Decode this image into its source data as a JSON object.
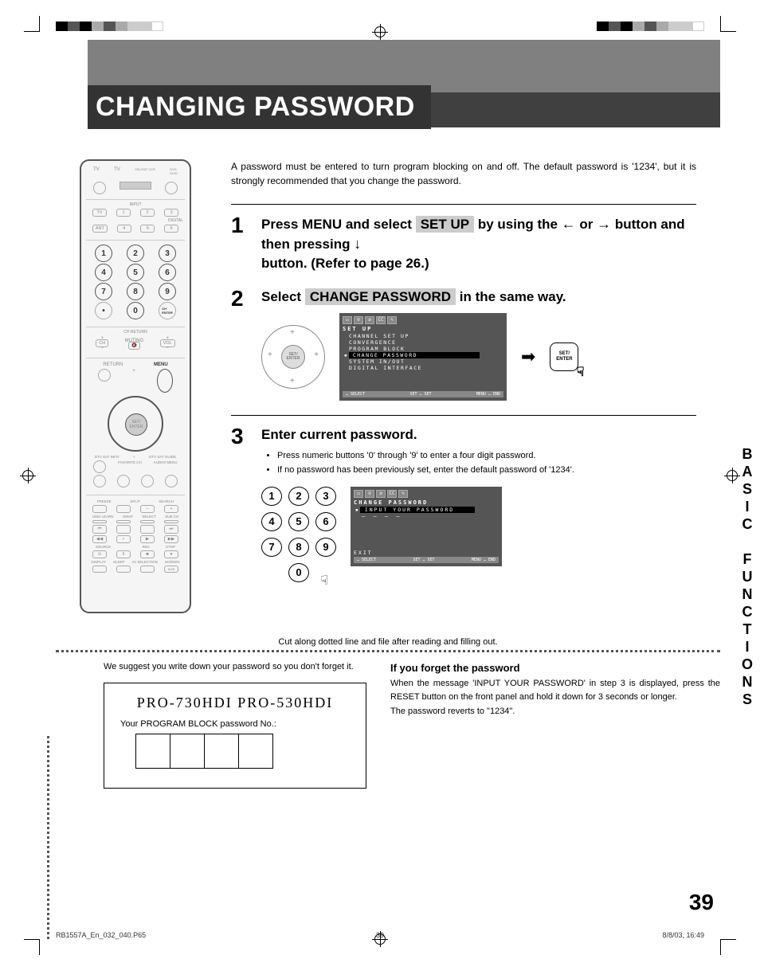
{
  "title": "CHANGING PASSWORD",
  "intro": "A password must be entered to turn program blocking on and off. The default password is '1234', but it is strongly recommended that you change the password.",
  "steps": {
    "s1": {
      "num": "1",
      "part1": "Press MENU and select ",
      "highlight": "SET UP",
      "part2": " by using the ",
      "arrow_left": "←",
      "part3": " or ",
      "arrow_right": "→",
      "part4": " button and then pressing ",
      "arrow_down": "↓",
      "part5": "button. (Refer to page 26.)"
    },
    "s2": {
      "num": "2",
      "part1": "Select ",
      "highlight": "CHANGE PASSWORD",
      "part2": " in the same way."
    },
    "s3": {
      "num": "3",
      "title": "Enter current password.",
      "bullet1": "Press numeric buttons '0' through '9' to enter a four digit password.",
      "bullet2": "If no password has been previously set, enter the default password of '1234'."
    }
  },
  "tv_menu": {
    "header": "SET UP",
    "items": [
      "CHANNEL SET UP",
      "CONVERGENCE",
      "PROGRAM BLOCK",
      "CHANGE PASSWORD",
      "SYSTEM IN/OUT",
      "DIGITAL INTERFACE"
    ],
    "footer_select": "… SELECT",
    "footer_set": "SET … SET",
    "footer_end": "MENU … END",
    "icon_cc": "CC"
  },
  "tv_password": {
    "header": "CHANGE PASSWORD",
    "prompt": "INPUT YOUR PASSWORD",
    "exit": "EXIT",
    "underscores": "— — — —"
  },
  "enter_button": {
    "line1": "SET/",
    "line2": "ENTER"
  },
  "keypad": [
    "1",
    "2",
    "3",
    "4",
    "5",
    "6",
    "7",
    "8",
    "9",
    "0"
  ],
  "vertical_label": "BASIC FUNCTIONS",
  "cut_label": "Cut along dotted line and file after reading and filling out.",
  "suggestion": "We suggest you write down your password so you don't forget it.",
  "card": {
    "title": "PRO-730HDI PRO-530HDI",
    "label": "Your PROGRAM BLOCK password No.:"
  },
  "forget": {
    "title": "If you forget the password",
    "text1": "When the message 'INPUT YOUR PASSWORD' in step 3 is displayed, press the RESET button on the front panel and hold it down for 3 seconds or longer.",
    "text2": "The password reverts to \"1234\"."
  },
  "page_num": "39",
  "footer": {
    "left": "RB1557A_En_032_040.P65",
    "center": "39",
    "right": "8/8/03, 16:49"
  },
  "remote": {
    "input_label": "INPUT",
    "digital_label": "DIGITAL",
    "tv": "TV",
    "ant": "ANT",
    "nums": [
      "1",
      "2",
      "3",
      "4",
      "5",
      "6",
      "7",
      "8",
      "9",
      "0"
    ],
    "ch": "CH",
    "vol": "VOL",
    "muting": "MUTING",
    "return": "RETURN",
    "menu": "MENU",
    "ch_return": "CH RETURN",
    "set_enter": "SET/\nENTER",
    "dtv_info": "DTV\nSAT\nINFO",
    "dtv_guide": "DTV\nSAT\nGUIDE",
    "fav": "FAVORITE CH",
    "audio_menu": "AUDIO/\nMENU",
    "freeze": "FREEZE",
    "split": "SPLIT",
    "search": "SEARCH",
    "learn": "USE/\nLEARN",
    "swap": "SWAP",
    "select": "SELECT",
    "subch": "SUB CH",
    "source": "SOURCE",
    "rec": "REC",
    "stop": "STOP",
    "display": "DISPLAY",
    "sleep": "SLEEP",
    "av_sel": "AV\nSELECTION",
    "screen": "SCREEN"
  }
}
